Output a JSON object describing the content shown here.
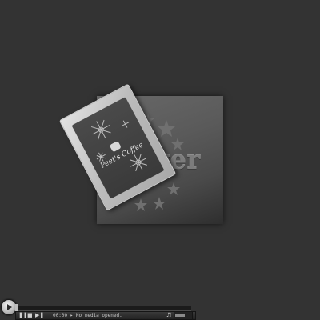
{
  "album": {
    "wordmark": "layer"
  },
  "coffee_bag": {
    "brand": "Peet's Coffee"
  },
  "player": {
    "status": "00:00 ▸ No media opened.",
    "progress_fraction": 0.0,
    "volume_fraction": 0.6,
    "icons": {
      "play": "play-icon",
      "stop": "stop-icon",
      "next": "next-icon",
      "volume": "volume-icon"
    }
  }
}
